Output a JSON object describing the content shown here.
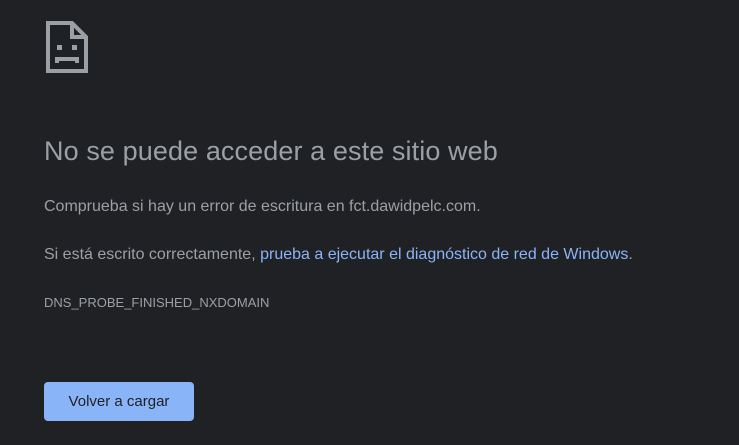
{
  "error_page": {
    "icon": "sad-page-icon",
    "title": "No se puede acceder a este sitio web",
    "check_text": "Comprueba si hay un error de escritura en fct.dawidpelc.com.",
    "diagnostic_prefix": "Si está escrito correctamente, ",
    "diagnostic_link": "prueba a ejecutar el diagnóstico de red de Windows",
    "diagnostic_suffix": ".",
    "error_code": "DNS_PROBE_FINISHED_NXDOMAIN",
    "reload_label": "Volver a cargar"
  },
  "colors": {
    "background": "#202124",
    "text": "#9aa0a6",
    "link": "#8ab4f8",
    "button_bg": "#8ab4f8",
    "button_text": "#202124"
  }
}
